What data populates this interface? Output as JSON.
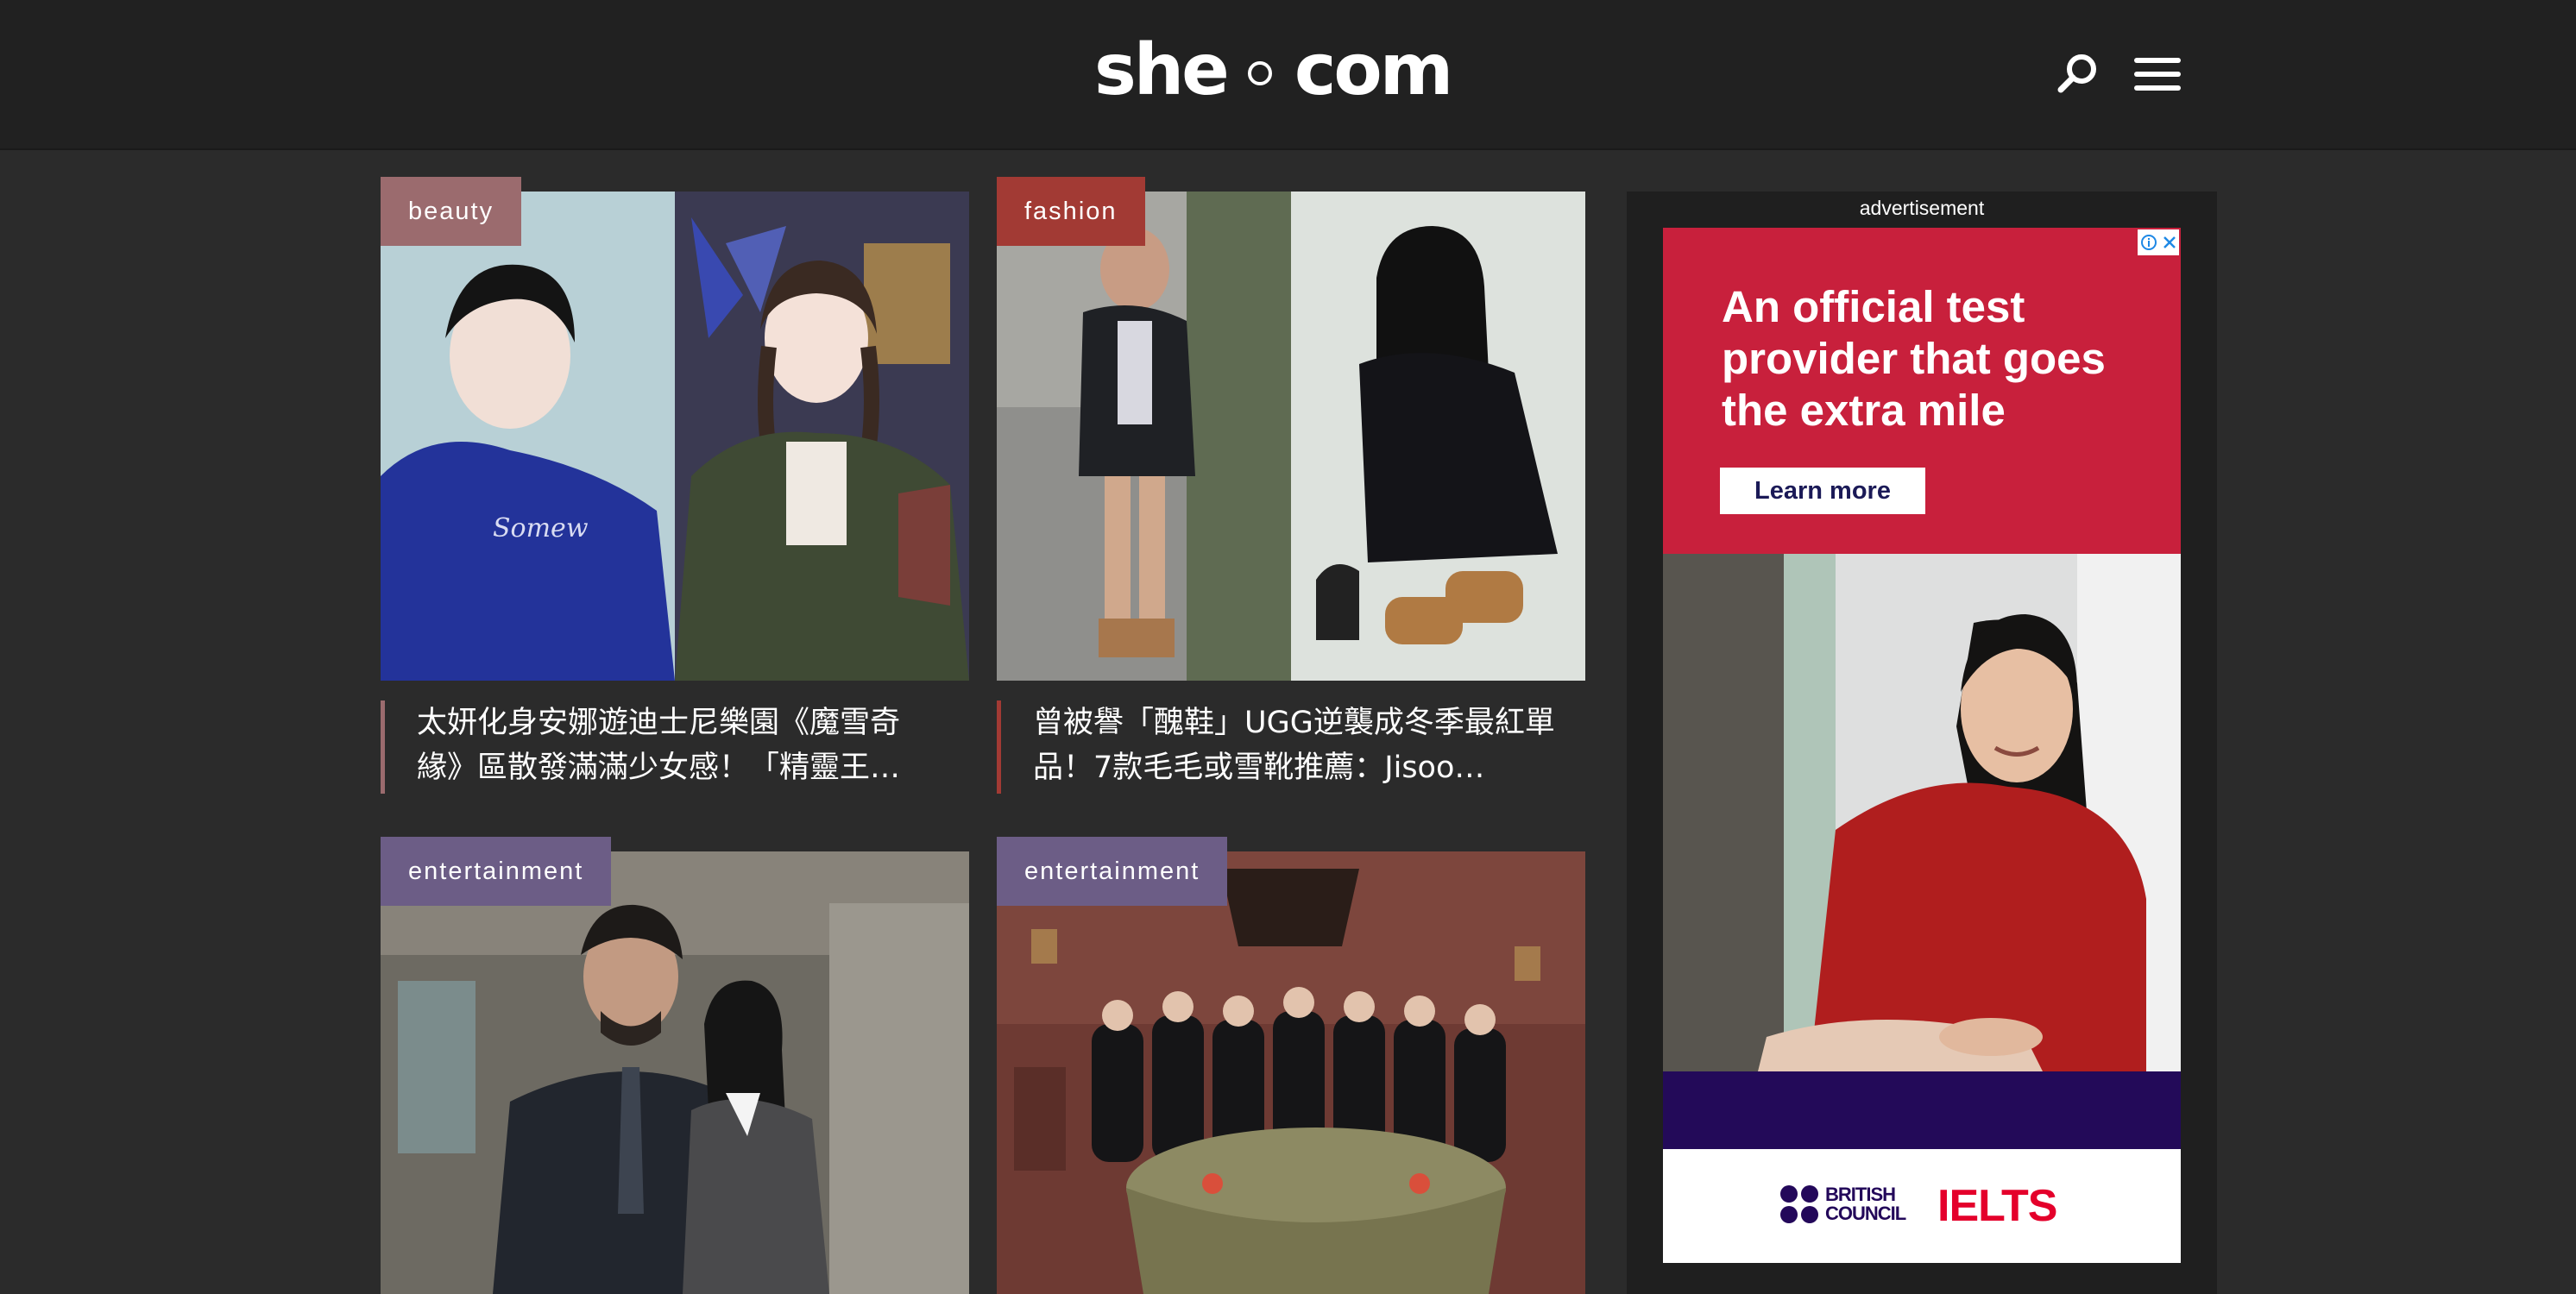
{
  "header": {
    "logo_left": "she",
    "logo_right": "com",
    "search_icon": "search-icon",
    "menu_icon": "hamburger-menu-icon"
  },
  "articles": [
    {
      "tag": "beauty",
      "title": "太妍化身安娜遊迪士尼樂園《魔雪奇緣》區散發滿滿少女感！「精靈王…",
      "tag_color": "#9b6b6e"
    },
    {
      "tag": "fashion",
      "title": "曾被譽「醜鞋」UGG逆襲成冬季最紅單品！7款毛毛或雪靴推薦：Jisoo…",
      "tag_color": "#a23a34"
    },
    {
      "tag": "entertainment",
      "title": "",
      "tag_color": "#6c5d86"
    },
    {
      "tag": "entertainment",
      "title": "",
      "tag_color": "#6c5d86"
    }
  ],
  "ad": {
    "label": "advertisement",
    "headline": "An official test provider that goes the extra mile",
    "cta": "Learn more",
    "brand_text": "BRITISH COUNCIL",
    "product": "IELTS",
    "colors": {
      "red": "#c8203c",
      "navy": "#230a59",
      "ielts_red": "#e4002b"
    }
  }
}
